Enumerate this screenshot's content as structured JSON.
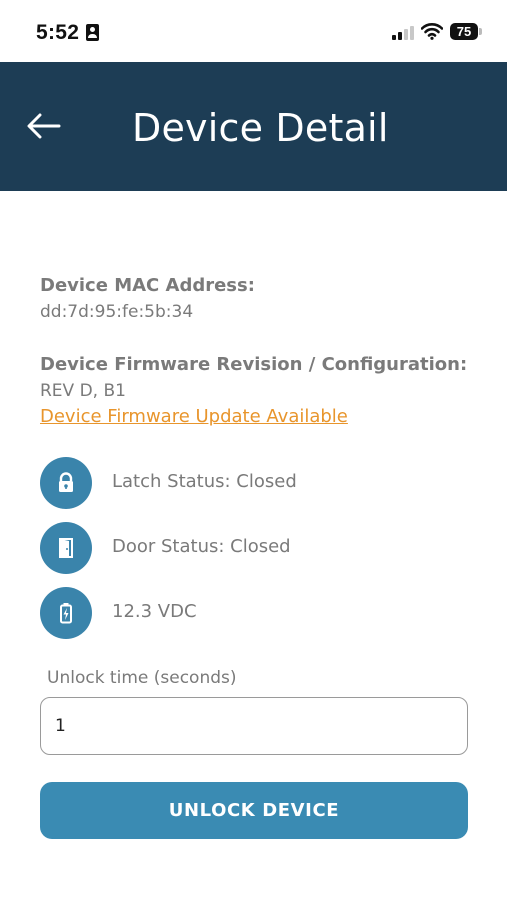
{
  "status_bar": {
    "time": "5:52",
    "battery": "75"
  },
  "header": {
    "title": "Device Detail",
    "back_icon": "back-arrow-icon"
  },
  "device": {
    "mac_label": "Device MAC Address:",
    "mac_value": "dd:7d:95:fe:5b:34",
    "firmware_label": "Device Firmware Revision / Configuration:",
    "firmware_value": "REV D, B1",
    "update_link": "Device Firmware Update Available"
  },
  "statuses": [
    {
      "icon": "lock-icon",
      "text": "Latch Status: Closed"
    },
    {
      "icon": "door-icon",
      "text": "Door Status: Closed"
    },
    {
      "icon": "battery-charging-icon",
      "text": "12.3 VDC"
    }
  ],
  "unlock": {
    "label": "Unlock time (seconds)",
    "value": "1",
    "button_label": "UNLOCK DEVICE"
  },
  "colors": {
    "header_bg": "#1d3d55",
    "accent": "#3a8bb3",
    "link": "#e8952c"
  }
}
